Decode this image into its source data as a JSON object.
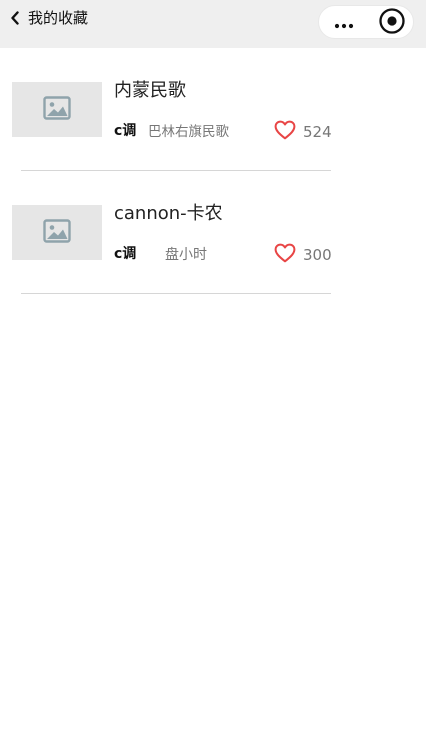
{
  "navbar": {
    "back_icon": "chevron-left-icon",
    "title": "我的收藏",
    "more_icon": "more-dots-icon",
    "close_icon": "target-circle-icon"
  },
  "songs": [
    {
      "cover_icon": "image-placeholder-icon",
      "title": "内蒙民歌",
      "key": "c调",
      "singer": "巴林右旗民歌",
      "like_icon": "heart-outline-icon",
      "likes": "524"
    },
    {
      "cover_icon": "image-placeholder-icon",
      "title": "cannon-卡农",
      "key": "c调",
      "singer": "盘小时",
      "like_icon": "heart-outline-icon",
      "likes": "300"
    }
  ],
  "colors": {
    "navbar_bg": "#efefef",
    "heart": "#e84545",
    "cover_bg": "#e6e6e6",
    "cover_icon": "#8fa3ab"
  }
}
